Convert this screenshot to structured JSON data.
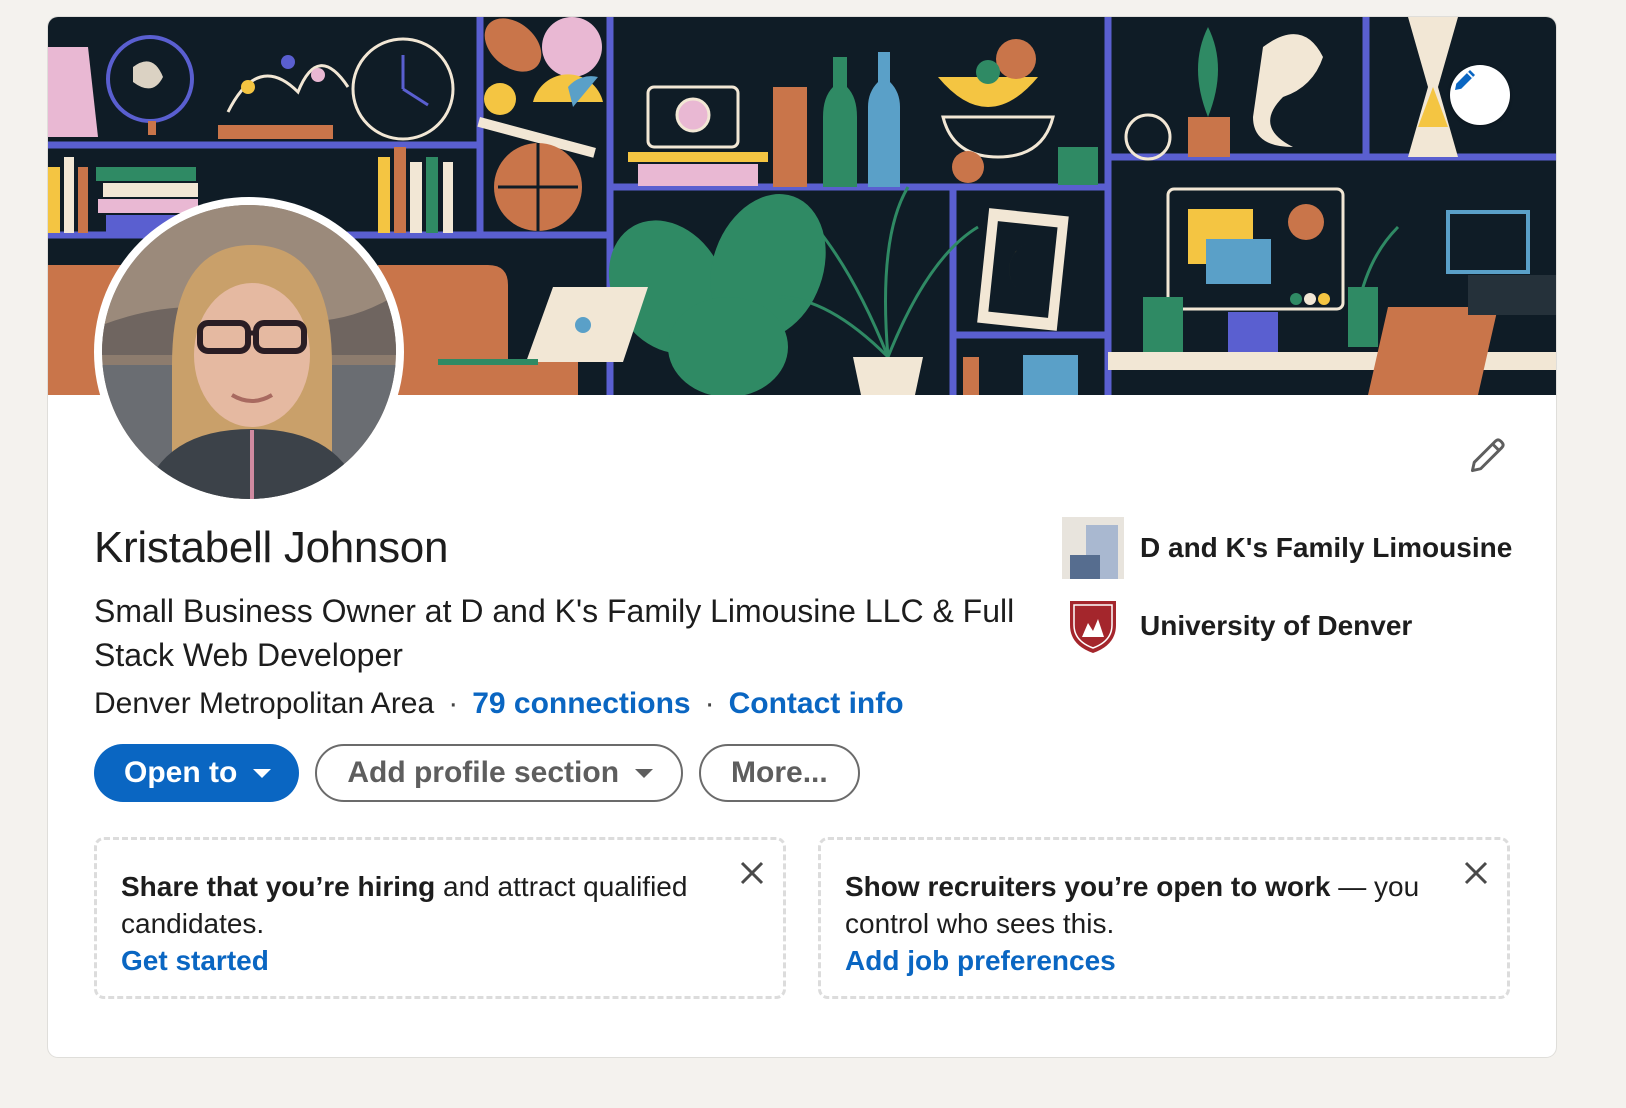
{
  "profile": {
    "name": "Kristabell Johnson",
    "headline": "Small Business Owner at D and K's Family Limousine LLC & Full Stack Web Developer",
    "location": "Denver Metropolitan Area",
    "separator": "·",
    "connections": "79 connections",
    "contact_info": "Contact info"
  },
  "actions": {
    "open_to": "Open to",
    "add_profile_section": "Add profile section",
    "more": "More..."
  },
  "organizations": [
    {
      "name": "D and K's Family Limousine",
      "logo": "company-logo"
    },
    {
      "name": "University of Denver",
      "logo": "university-crest"
    }
  ],
  "promos": [
    {
      "bold": "Share that you’re hiring",
      "rest": " and attract qualified candidates.",
      "link": "Get started"
    },
    {
      "bold": "Show recruiters you’re open to work",
      "rest": " — you control who sees this.",
      "link": "Add job preferences"
    }
  ],
  "icons": {
    "banner_edit": "pencil-icon",
    "intro_edit": "pencil-icon",
    "dismiss": "close-icon",
    "dropdown": "caret-down-icon"
  },
  "colors": {
    "brand_blue": "#0a66c2",
    "banner_bg": "#0f1c26",
    "page_bg": "#f4f2ee"
  }
}
